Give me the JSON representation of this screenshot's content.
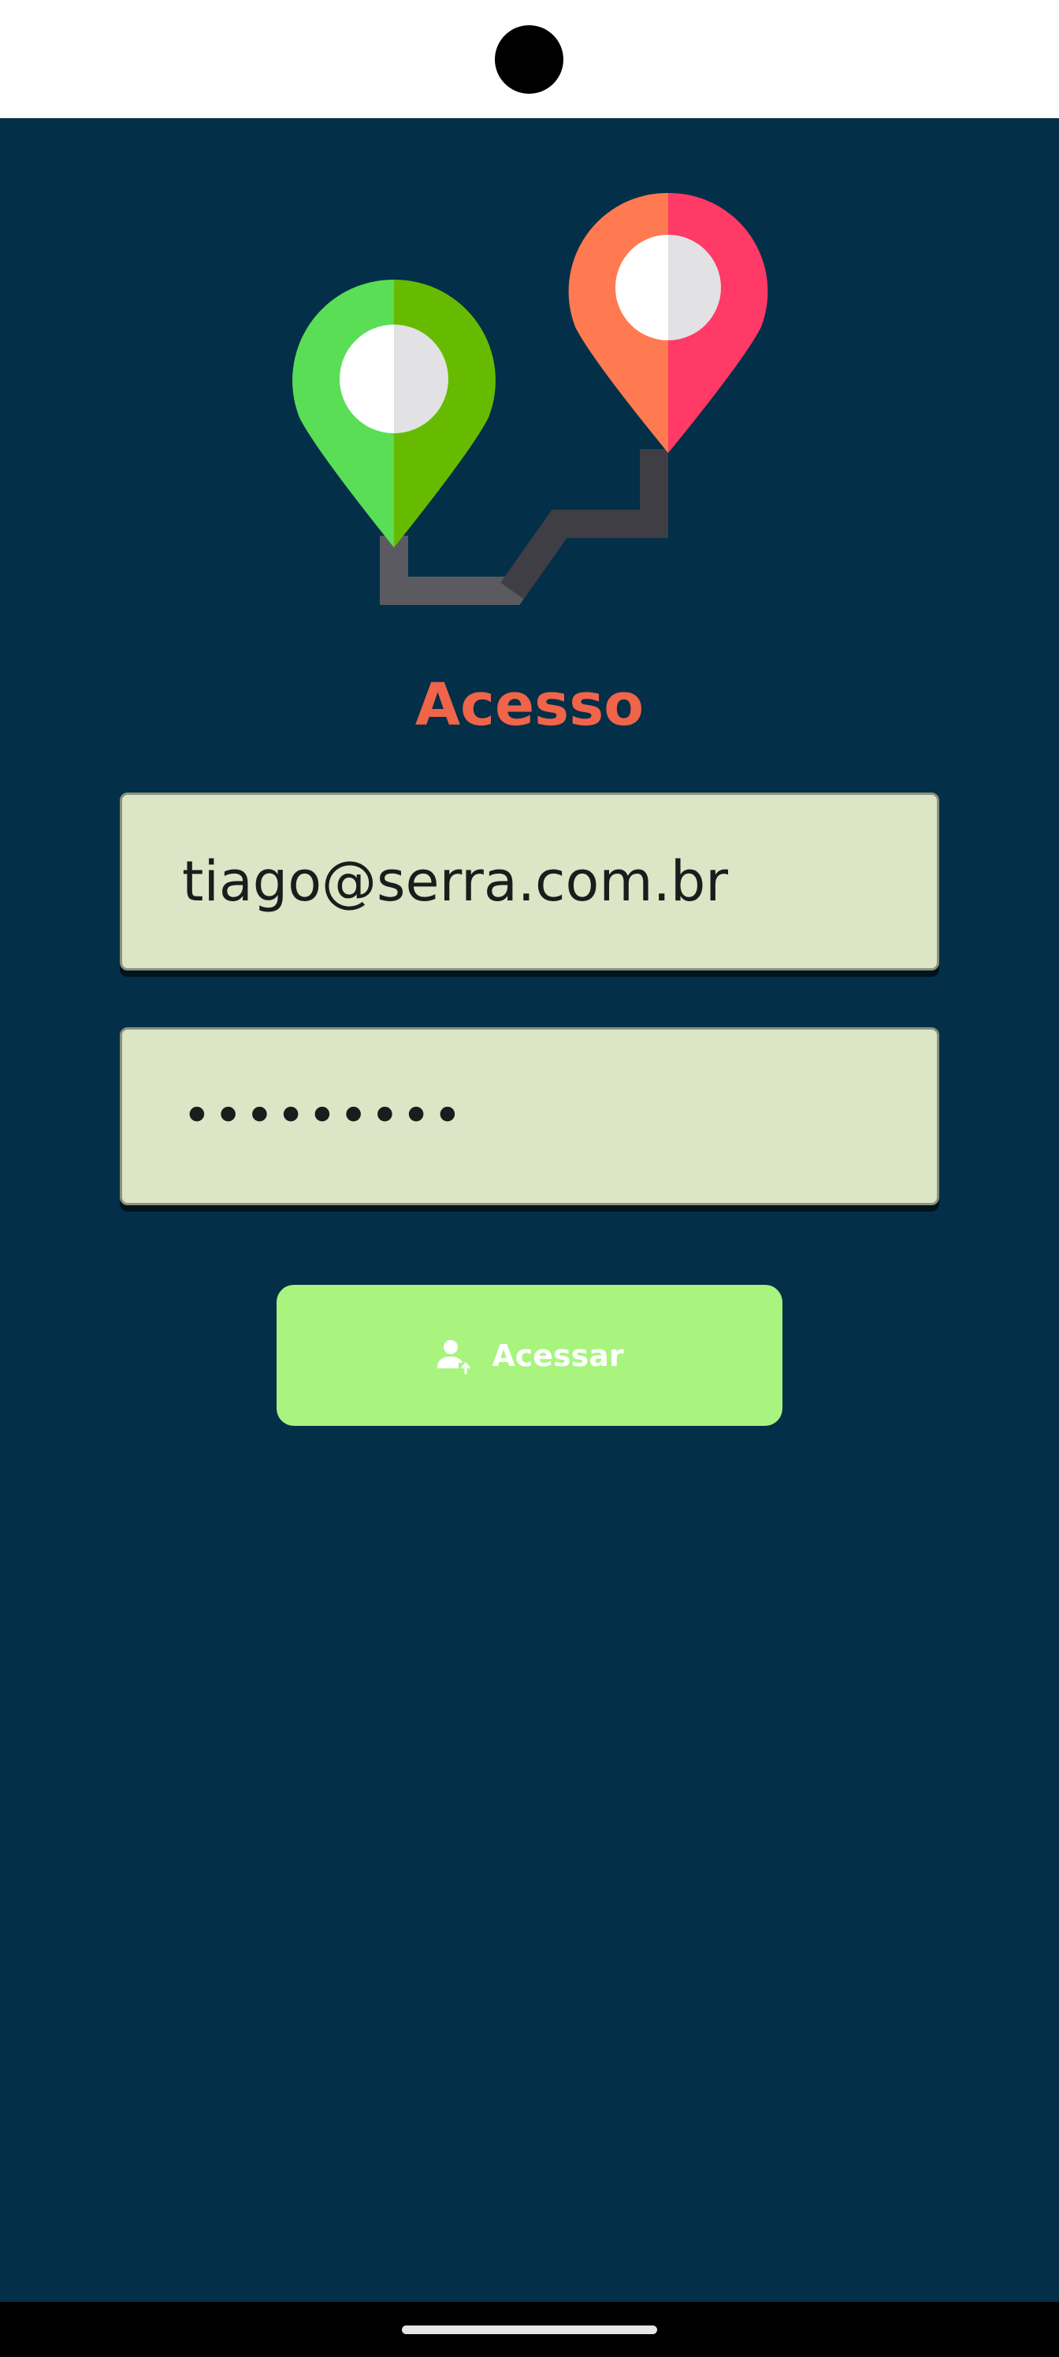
{
  "login": {
    "title": "Acesso",
    "email_value": "tiago@serra.com.br",
    "password_mask": "•••••••••",
    "submit_label": "Acessar",
    "submit_icon": "person-login-icon"
  },
  "logo": {
    "icon": "route-pins-icon"
  },
  "colors": {
    "background": "#032f48",
    "title": "#f06449",
    "field_background": "#dce5c6",
    "button_background": "#a8f47f",
    "button_text": "#ffffff"
  }
}
